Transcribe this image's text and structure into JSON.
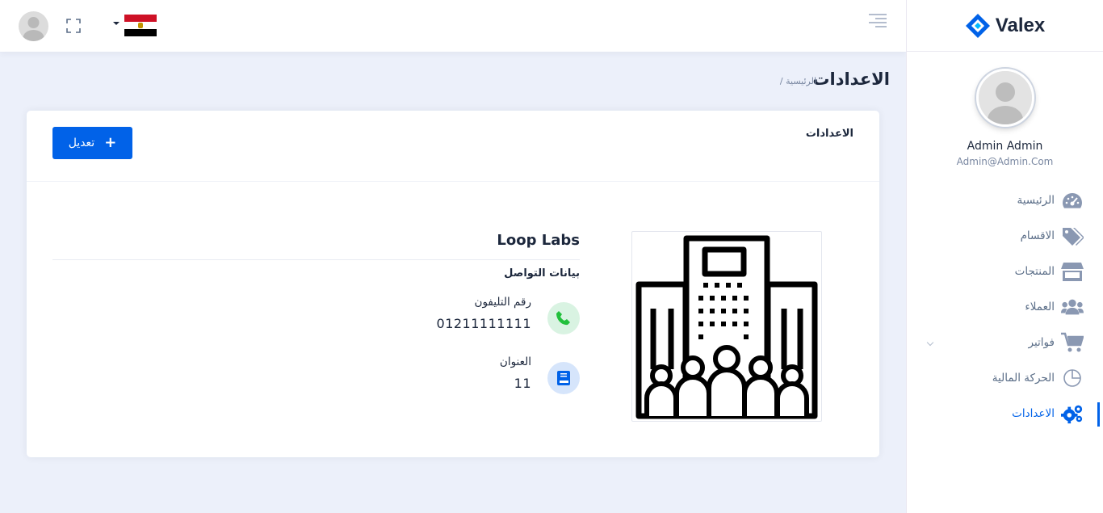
{
  "header": {
    "language_flag": "egypt-flag",
    "icons": [
      "user-avatar-icon",
      "fullscreen-icon",
      "menu-toggle-icon"
    ]
  },
  "sidebar": {
    "logo_text": "Valex",
    "user_name": "Admin Admin",
    "user_email": "Admin@Admin.Com",
    "items": [
      {
        "label": "الرئيسية",
        "icon": "dashboard-gauge-icon"
      },
      {
        "label": "الاقسام",
        "icon": "tags-icon"
      },
      {
        "label": "المنتجات",
        "icon": "store-icon"
      },
      {
        "label": "العملاء",
        "icon": "users-icon"
      },
      {
        "label": "فواتير",
        "icon": "cart-icon"
      },
      {
        "label": "الحركة المالية",
        "icon": "pie-chart-icon"
      },
      {
        "label": "الاعدادات",
        "icon": "cogs-icon"
      }
    ],
    "active_index": 6,
    "accent_color": "#0162e8"
  },
  "breadcrumb": {
    "title": "الاعدادات",
    "trail": "/ الرئيسية"
  },
  "card": {
    "title": "الاعدادات",
    "edit_button": "تعديل",
    "company_name": "Loop Labs",
    "contact_title": "بيانات التواصل",
    "phone_label": "رقم التليفون",
    "phone_value": "01211111111",
    "address_label": "العنوان",
    "address_value": "11"
  }
}
